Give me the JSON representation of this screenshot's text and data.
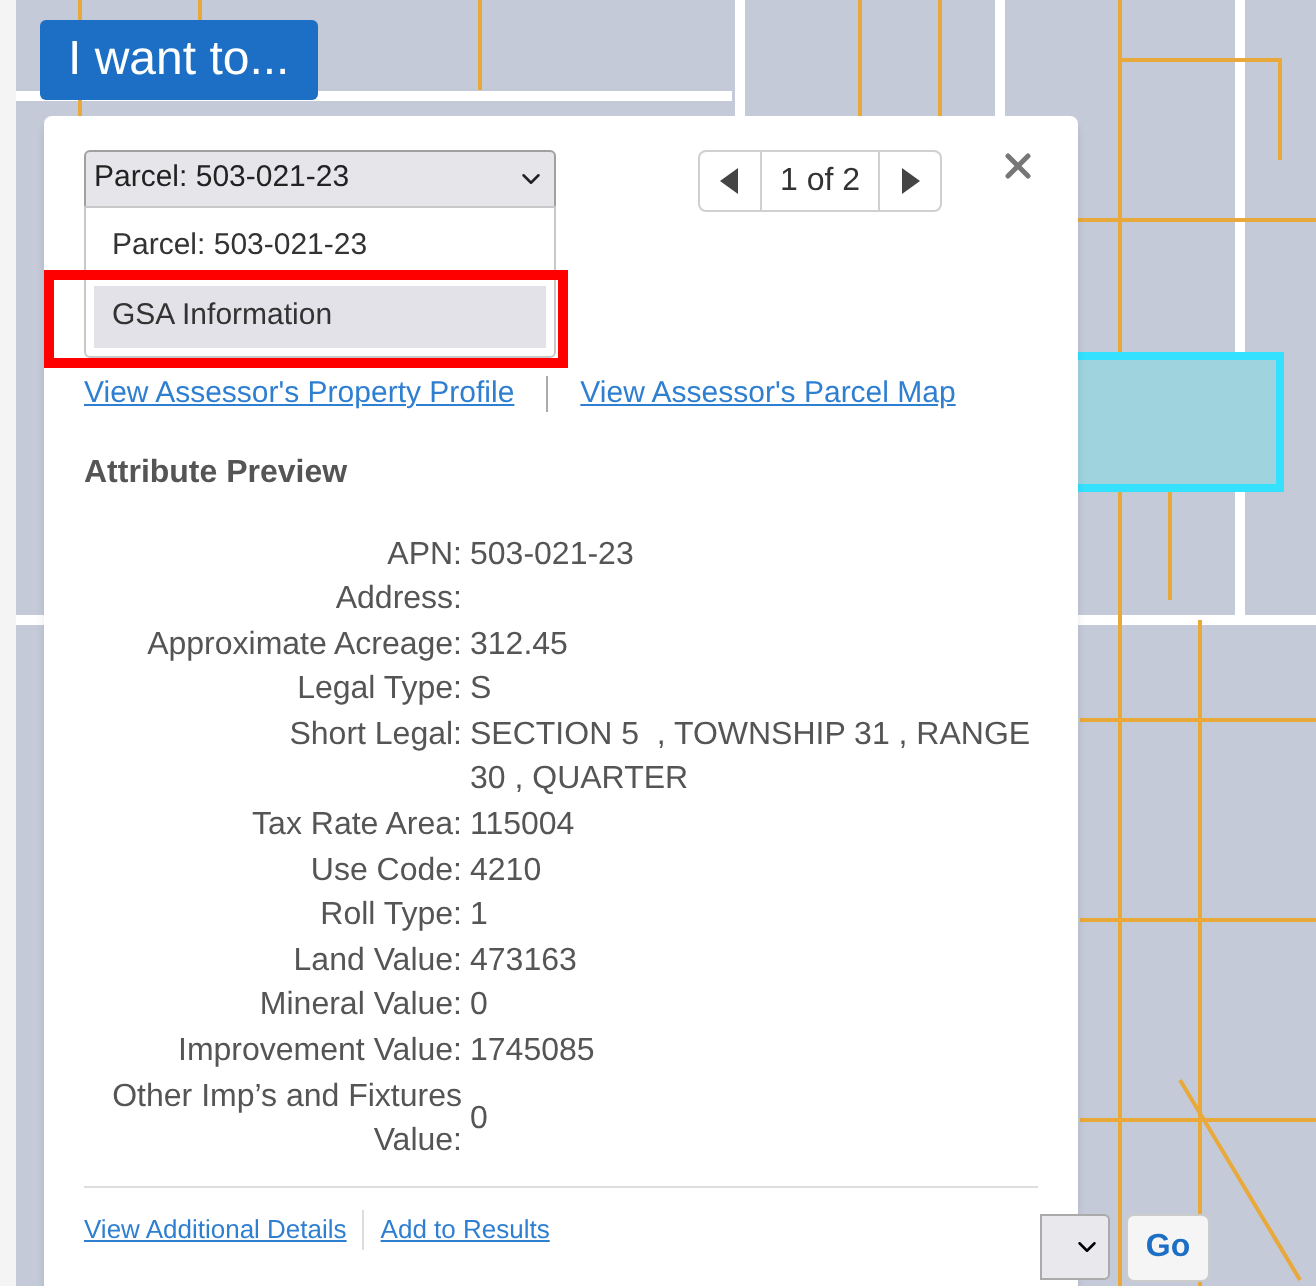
{
  "launcher": {
    "label": "I want to..."
  },
  "popup": {
    "select": {
      "value": "Parcel: 503-021-23",
      "expanded": true,
      "options": [
        {
          "label": "Parcel: 503-021-23",
          "highlighted": false,
          "outlined": false
        },
        {
          "label": "GSA Information",
          "highlighted": true,
          "outlined": true
        }
      ]
    },
    "pager": {
      "text": "1 of 2"
    },
    "links": [
      "View Assessor's Property Profile",
      "View Assessor's Parcel Map"
    ],
    "section_title": "Attribute Preview",
    "attributes": [
      {
        "label": "APN:",
        "value": "503-021-23"
      },
      {
        "label": "Address:"
      },
      {
        "label": "Approximate Acreage:",
        "value": "312.45"
      },
      {
        "label": "Legal Type:",
        "value": "S"
      },
      {
        "label": "Short Legal:",
        "value": "SECTION 5  , TOWNSHIP 31 , RANGE 30 , QUARTER"
      },
      {
        "label": "Tax Rate Area:",
        "value": "115004"
      },
      {
        "label": "Use Code:",
        "value": "4210"
      },
      {
        "label": "Roll Type:",
        "value": "1"
      },
      {
        "label": "Land Value:",
        "value": "473163"
      },
      {
        "label": "Mineral Value:",
        "value": "0"
      },
      {
        "label": "Improvement Value:",
        "value": "1745085"
      },
      {
        "label": "Other Imp’s and Fixtures Value:",
        "value": "0"
      }
    ],
    "footer_links": [
      "View Additional Details",
      "Add to Results"
    ]
  },
  "search_bar": {
    "button": "Go"
  }
}
